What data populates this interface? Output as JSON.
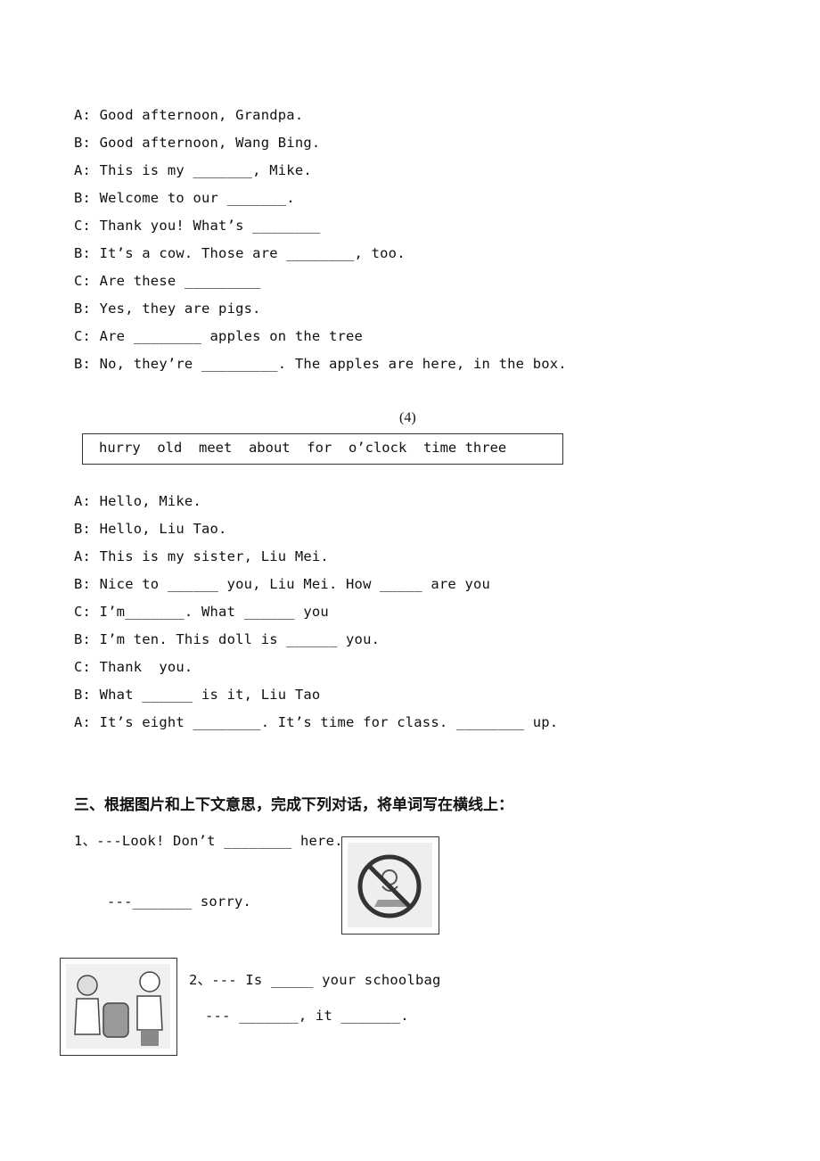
{
  "dialogue3": [
    "A: Good afternoon, Grandpa.",
    "B: Good afternoon, Wang Bing.",
    "A: This is my _______, Mike.",
    "B: Welcome to our _______.",
    "C: Thank you! What’s ________",
    "B: It’s a cow. Those are ________, too.",
    "C: Are these _________",
    "B: Yes, they are pigs.",
    "C: Are ________ apples on the tree",
    "B: No, they’re _________. The apples are here, in the box."
  ],
  "section4": {
    "number": "(4)",
    "word_bank": "hurry  old  meet  about  for  o’clock  time three"
  },
  "dialogue4": [
    "A: Hello, Mike.",
    "B: Hello, Liu Tao.",
    "A: This is my sister, Liu Mei.",
    "B: Nice to ______ you, Liu Mei. How _____ are you",
    "C: I’m_______. What ______ you",
    "B: I’m ten. This doll is ______ you.",
    "C: Thank  you.",
    "B: What ______ is it, Liu Tao",
    "A: It’s eight ________. It’s time for class. ________ up."
  ],
  "part3": {
    "heading": "三、根据图片和上下文意思，完成下列对话，将单词写在横线上：",
    "q1_line1": "1、---Look! Don’t ________ here.",
    "q1_line2": "---_______ sorry.",
    "q2_line1": "2、--- Is _____ your schoolbag",
    "q2_line2": "--- _______, it _______."
  }
}
